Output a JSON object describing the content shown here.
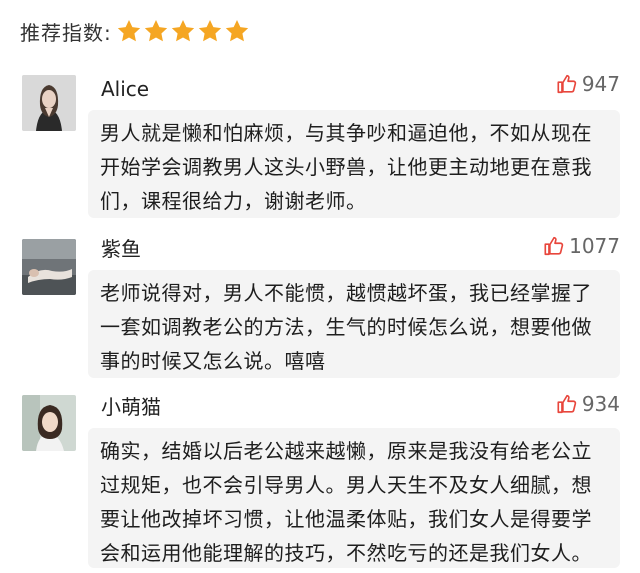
{
  "rating": {
    "label": "推荐指数:",
    "stars_filled": 5,
    "stars_total": 5,
    "star_color": "#f5a623"
  },
  "colors": {
    "like_icon": "#e8463c",
    "bubble_bg": "#f4f4f4"
  },
  "comments": [
    {
      "username": "Alice",
      "likes": "947",
      "avatar_icon": "avatar-photo",
      "text": "男人就是懒和怕麻烦，与其争吵和逼迫他，不如从现在开始学会调教男人这头小野兽，让他更主动地更在意我们，课程很给力，谢谢老师。"
    },
    {
      "username": "紫鱼",
      "likes": "1077",
      "avatar_icon": "avatar-photo",
      "text": "老师说得对，男人不能惯，越惯越坏蛋，我已经掌握了一套如调教老公的方法，生气的时候怎么说，想要他做事的时候又怎么说。嘻嘻"
    },
    {
      "username": "小萌猫",
      "likes": "934",
      "avatar_icon": "avatar-photo",
      "text": "确实，结婚以后老公越来越懒，原来是我没有给老公立过规矩，也不会引导男人。男人天生不及女人细腻，想要让他改掉坏习惯，让他温柔体贴，我们女人是得要学会和运用他能理解的技巧，不然吃亏的还是我们女人。"
    }
  ]
}
